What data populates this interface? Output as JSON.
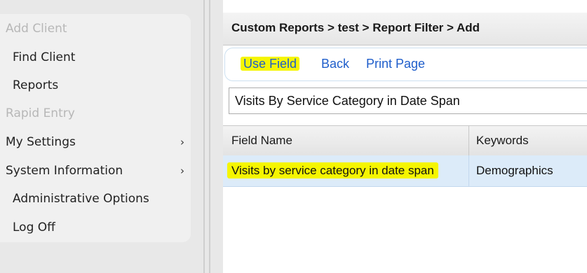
{
  "sidebar": {
    "items": [
      {
        "label": "Add Client",
        "disabled": true,
        "chevron": false
      },
      {
        "label": "Find Client",
        "disabled": false,
        "chevron": false
      },
      {
        "label": "Reports",
        "disabled": false,
        "chevron": false
      },
      {
        "label": "Rapid Entry",
        "disabled": true,
        "chevron": false
      },
      {
        "label": "My Settings",
        "disabled": false,
        "chevron": true
      },
      {
        "label": "System Information",
        "disabled": false,
        "chevron": true
      },
      {
        "label": "Administrative Options",
        "disabled": false,
        "chevron": false
      },
      {
        "label": "Log Off",
        "disabled": false,
        "chevron": false
      }
    ],
    "chevron_glyph": "›"
  },
  "main": {
    "breadcrumb": "Custom Reports > test > Report Filter > Add",
    "toolbar": {
      "use_field_label": "Use Field",
      "back_label": "Back",
      "print_label": "Print Page"
    },
    "report_name": "Visits By Service Category in Date Span",
    "table": {
      "headers": [
        "Field Name",
        "Keywords"
      ],
      "rows": [
        [
          "Visits by service category in date span",
          "Demographics"
        ]
      ]
    }
  },
  "colors": {
    "link": "#1f5ecb",
    "highlight": "#f5f500",
    "selected_row": "#dcebf9",
    "disabled_text": "#b7b7b7"
  }
}
